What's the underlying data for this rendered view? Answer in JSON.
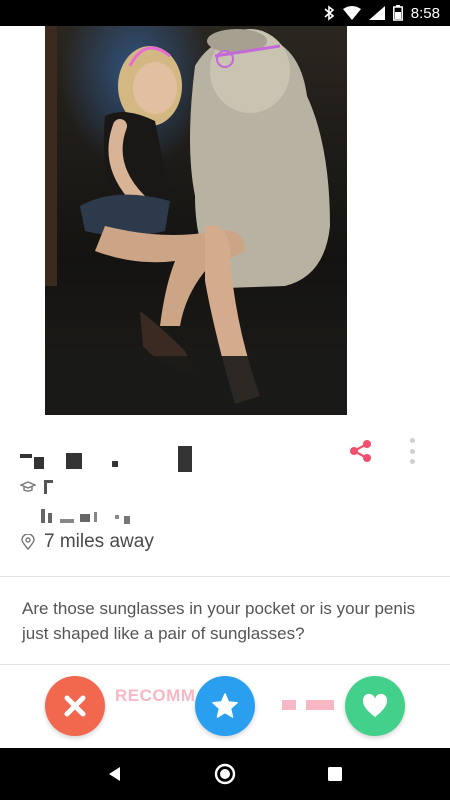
{
  "status_bar": {
    "time": "8:58",
    "icons": [
      "bluetooth-icon",
      "wifi-icon",
      "signal-icon",
      "battery-icon"
    ]
  },
  "profile": {
    "distance": "7 miles away",
    "icons": {
      "school": "graduation-cap-icon",
      "distance": "location-pin-icon"
    }
  },
  "bio": {
    "text": "Are those sunglasses in your pocket or is your penis just shaped like a pair of sunglasses?"
  },
  "actions": {
    "recommend_label": "RECOMM",
    "buttons": [
      "nope-icon",
      "super-like-star-icon",
      "like-heart-icon"
    ]
  },
  "colors": {
    "share": "#f0506e",
    "nope": "#f2684f",
    "super_like": "#2a9ff0",
    "like": "#43d08a",
    "recommend": "#f7b7c4"
  },
  "nav": [
    "back-icon",
    "home-icon",
    "recents-icon"
  ]
}
